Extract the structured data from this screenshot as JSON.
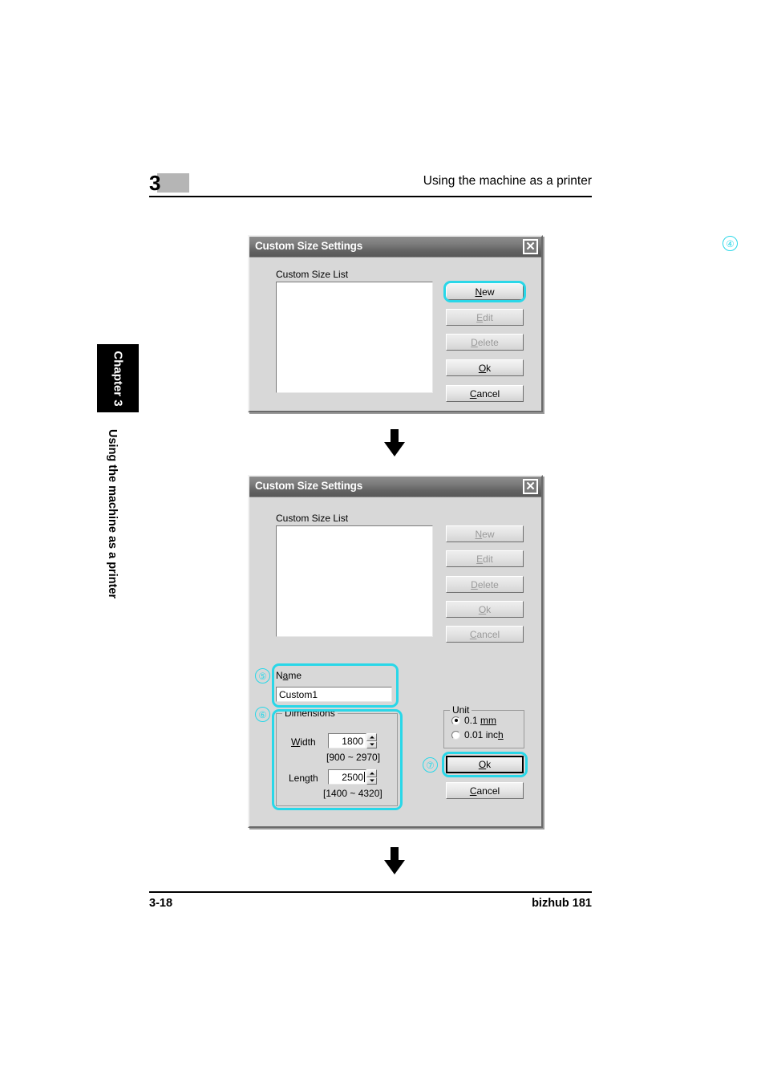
{
  "page": {
    "chapter_number": "3",
    "running_head": "Using the machine as a printer",
    "side_tab_label": "Chapter 3",
    "side_vertical_label": "Using the machine as a printer",
    "footer_left": "3-18",
    "footer_right": "bizhub 181"
  },
  "colors": {
    "callout": "#29d7e8",
    "highlight": "#29d7e8",
    "titlebar_dark": "#585858",
    "dialog_face": "#d8d8d8"
  },
  "dialog1": {
    "title": "Custom Size Settings",
    "close_icon": "✕",
    "list_label": "Custom Size List",
    "list_items": [],
    "callout": "④",
    "buttons": [
      {
        "label_pre": "",
        "accel": "N",
        "label_post": "ew",
        "text": "New",
        "state": "enabled",
        "highlighted": true
      },
      {
        "label_pre": "",
        "accel": "E",
        "label_post": "dit",
        "text": "Edit",
        "state": "disabled",
        "highlighted": false
      },
      {
        "label_pre": "",
        "accel": "D",
        "label_post": "elete",
        "text": "Delete",
        "state": "disabled",
        "highlighted": false
      },
      {
        "label_pre": "",
        "accel": "O",
        "label_post": "k",
        "text": "Ok",
        "state": "enabled",
        "highlighted": false
      },
      {
        "label_pre": "",
        "accel": "C",
        "label_post": "ancel",
        "text": "Cancel",
        "state": "enabled",
        "highlighted": false
      }
    ]
  },
  "dialog2": {
    "title": "Custom Size Settings",
    "close_icon": "✕",
    "list_label": "Custom Size List",
    "list_items": [],
    "buttons": [
      {
        "accel": "N",
        "label_post": "ew",
        "text": "New",
        "state": "disabled"
      },
      {
        "accel": "E",
        "label_post": "dit",
        "text": "Edit",
        "state": "disabled"
      },
      {
        "accel": "D",
        "label_post": "elete",
        "text": "Delete",
        "state": "disabled"
      },
      {
        "accel": "O",
        "label_post": "k",
        "text": "Ok",
        "state": "disabled"
      },
      {
        "accel": "C",
        "label_post": "ancel",
        "text": "Cancel",
        "state": "disabled"
      }
    ],
    "name_group": {
      "callout": "⑤",
      "label_accel": "a",
      "label_pre": "N",
      "label_post": "me",
      "label": "Name",
      "value": "Custom1",
      "highlighted": true
    },
    "dimensions_group": {
      "callout": "⑥",
      "label": "Dimensions",
      "highlighted": true,
      "fields": [
        {
          "label": "Width",
          "label_pre": "",
          "accel": "W",
          "label_post": "idth",
          "value": "1800",
          "range": "[900 ~ 2970]",
          "focused": false
        },
        {
          "label": "Length",
          "label_pre": "Len",
          "accel": "g",
          "label_post": "th",
          "value": "2500",
          "range": "[1400 ~ 4320]",
          "focused": true
        }
      ]
    },
    "unit_group": {
      "label": "Unit",
      "options": [
        {
          "label_pre": "0.1 ",
          "accel": "mm",
          "label_post": "",
          "text": "0.1 mm",
          "selected": true
        },
        {
          "label_pre": "0.01 inc",
          "accel": "h",
          "label_post": "",
          "text": "0.01 inch",
          "selected": false
        }
      ]
    },
    "action_buttons": [
      {
        "accel": "O",
        "label_post": "k",
        "text": "Ok",
        "callout": "⑦",
        "highlighted": true,
        "default": true
      },
      {
        "accel": "C",
        "label_post": "ancel",
        "text": "Cancel",
        "callout": "",
        "highlighted": false,
        "default": false
      }
    ]
  },
  "flow": {
    "arrow1": "down-arrow",
    "arrow2": "down-arrow"
  }
}
